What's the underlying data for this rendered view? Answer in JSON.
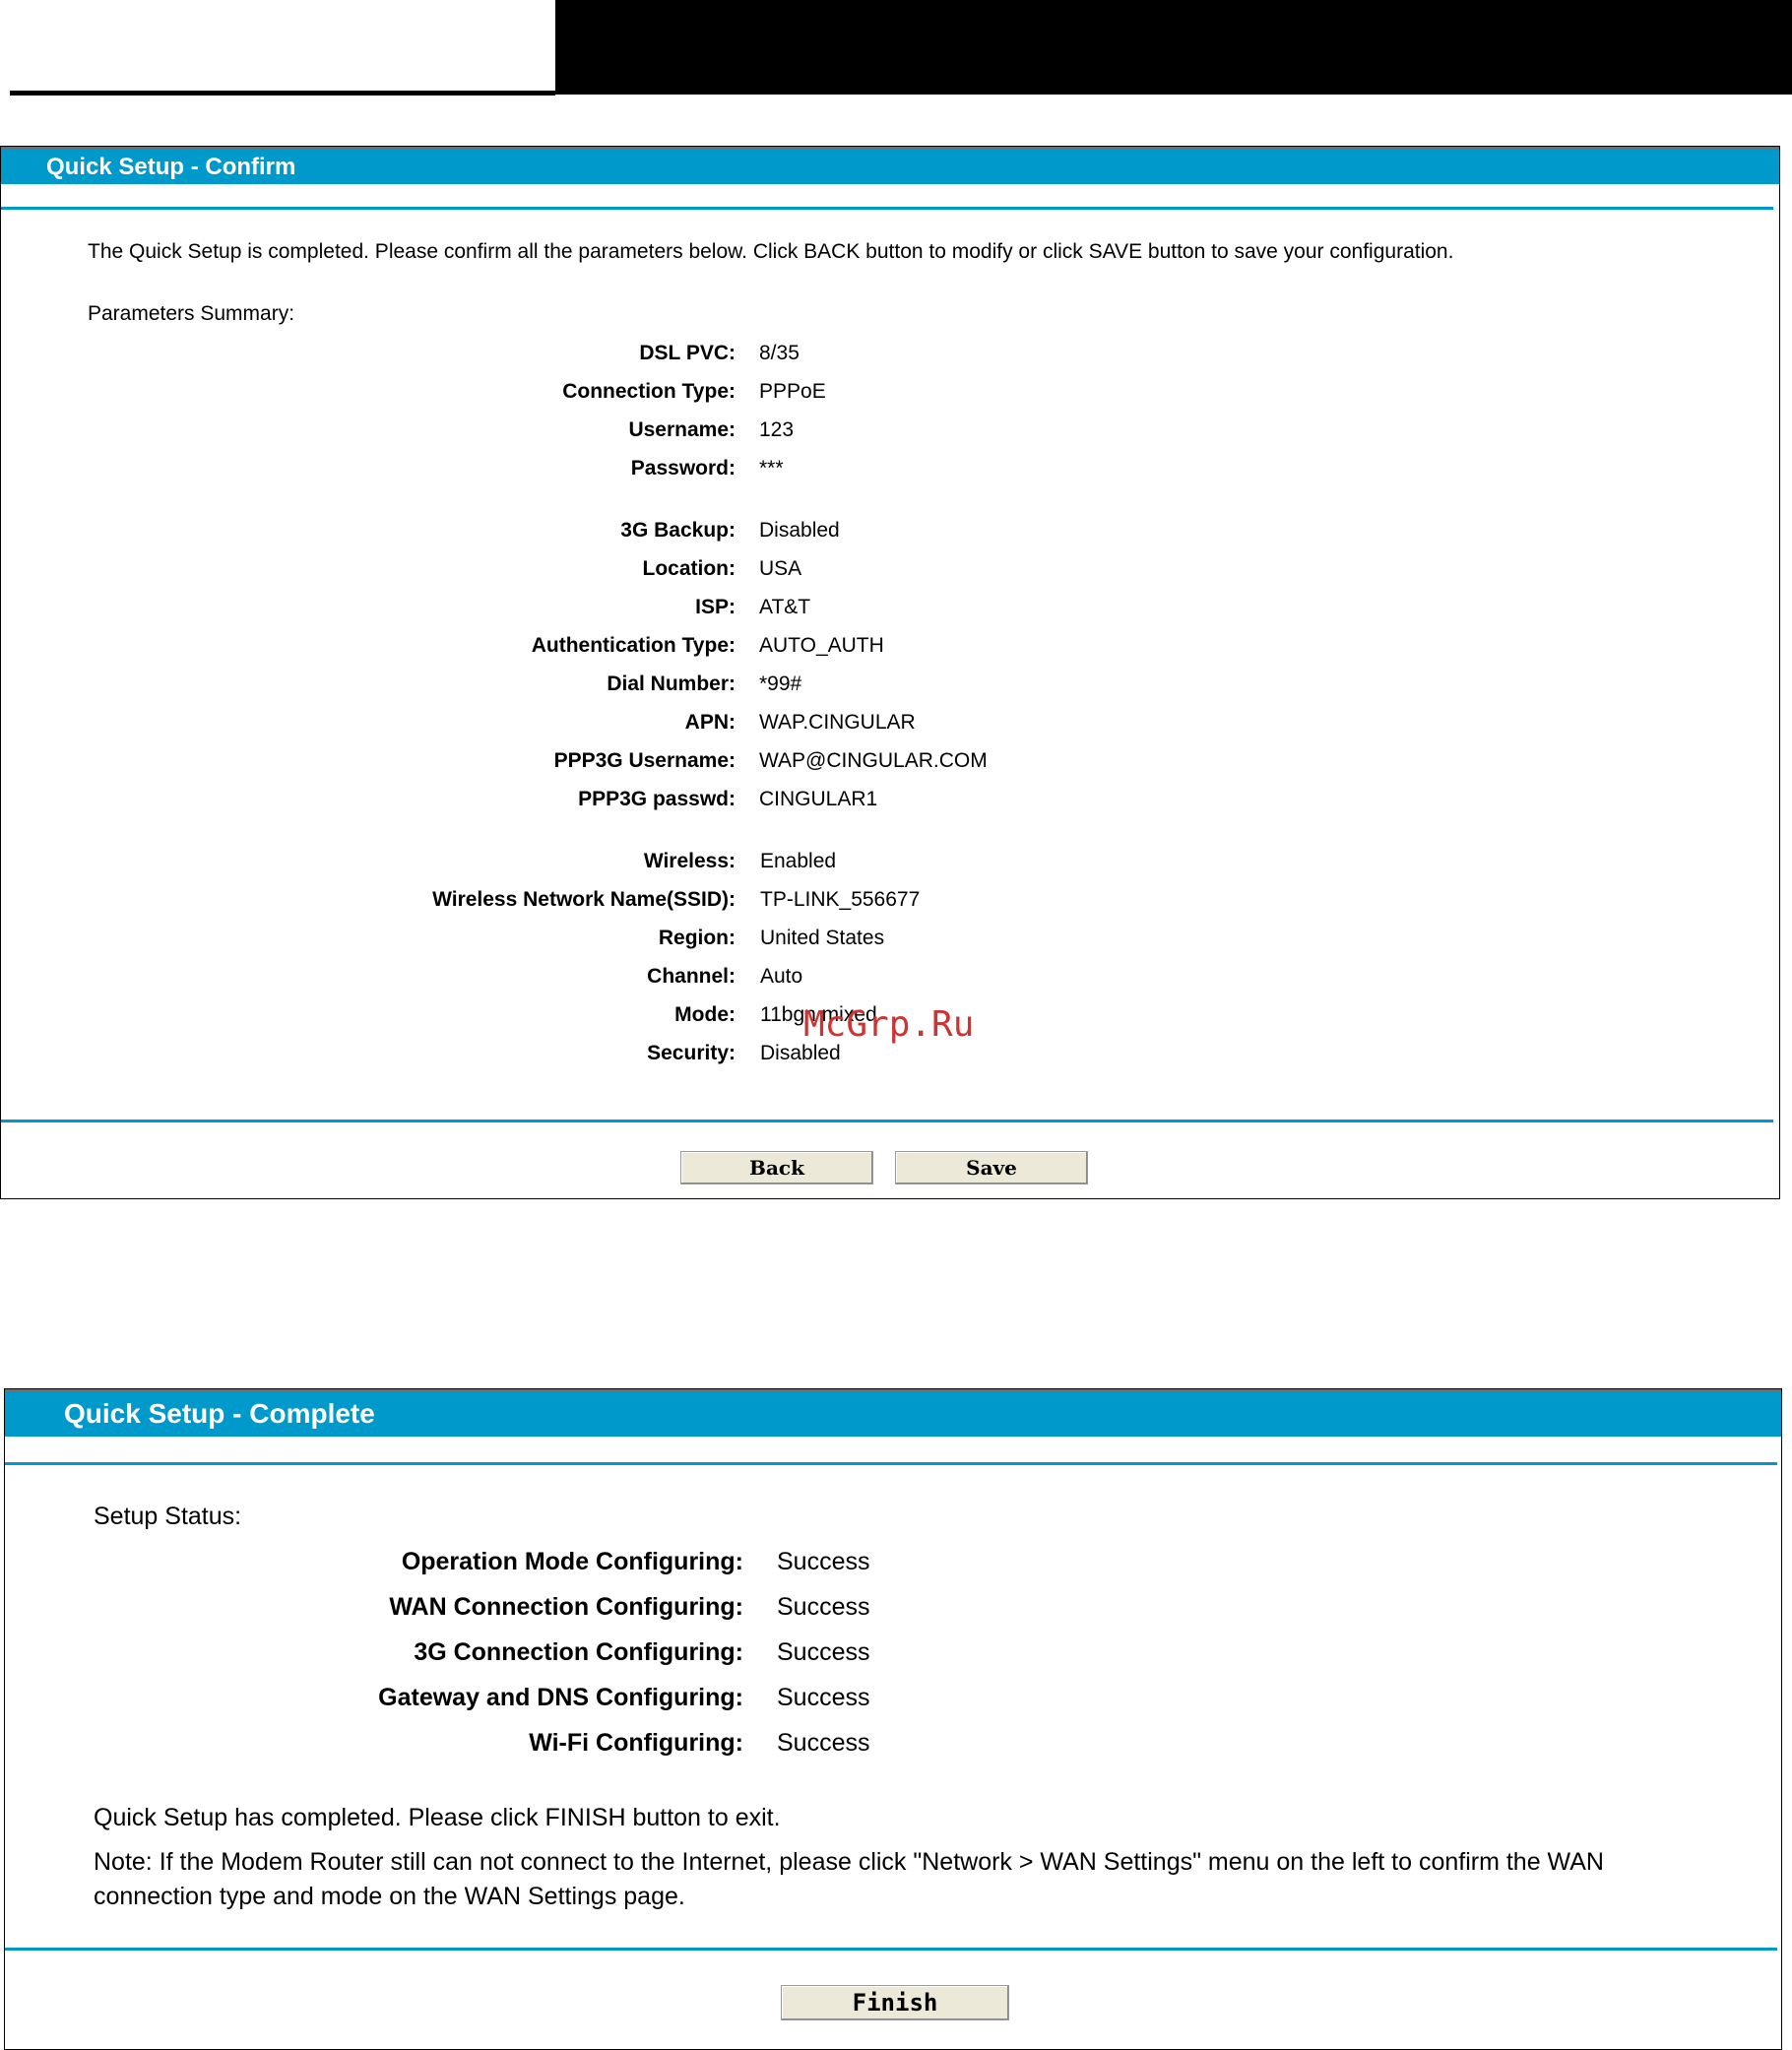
{
  "confirm": {
    "title": "Quick Setup - Confirm",
    "intro": "The Quick Setup is completed. Please confirm all the parameters below. Click BACK button to modify or click SAVE button to save your configuration.",
    "summary_label": "Parameters Summary:",
    "params": [
      {
        "label": "DSL PVC:",
        "value": "8/35"
      },
      {
        "label": "Connection Type:",
        "value": "PPPoE"
      },
      {
        "label": "Username:",
        "value": "123"
      },
      {
        "label": "Password:",
        "value": "***"
      },
      {
        "label": "3G Backup:",
        "value": "Disabled"
      },
      {
        "label": "Location:",
        "value": "USA"
      },
      {
        "label": "ISP:",
        "value": "AT&T"
      },
      {
        "label": "Authentication Type:",
        "value": "AUTO_AUTH"
      },
      {
        "label": "Dial Number:",
        "value": "*99#"
      },
      {
        "label": "APN:",
        "value": "WAP.CINGULAR"
      },
      {
        "label": "PPP3G Username:",
        "value": "WAP@CINGULAR.COM"
      },
      {
        "label": "PPP3G passwd:",
        "value": "CINGULAR1"
      },
      {
        "label": "Wireless:",
        "value": "Enabled"
      },
      {
        "label": "Wireless Network Name(SSID):",
        "value": "TP-LINK_556677"
      },
      {
        "label": "Region:",
        "value": "United States"
      },
      {
        "label": "Channel:",
        "value": "Auto"
      },
      {
        "label": "Mode:",
        "value": "11bgn mixed"
      },
      {
        "label": "Security:",
        "value": "Disabled"
      }
    ],
    "back_label": "Back",
    "save_label": "Save"
  },
  "complete": {
    "title": "Quick Setup - Complete",
    "status_label": "Setup Status:",
    "statuses": [
      {
        "label": "Operation Mode Configuring:",
        "value": "Success"
      },
      {
        "label": "WAN Connection Configuring:",
        "value": "Success"
      },
      {
        "label": "3G Connection Configuring:",
        "value": "Success"
      },
      {
        "label": "Gateway and DNS Configuring:",
        "value": "Success"
      },
      {
        "label": "Wi-Fi Configuring:",
        "value": "Success"
      }
    ],
    "finish_text": "Quick Setup has completed. Please click FINISH button to exit.",
    "note_line1": "Note: If the Modem Router still can not connect to the Internet, please click \"Network > WAN Settings\" menu on the left to confirm the WAN",
    "note_line2": "connection type and mode on the WAN Settings page.",
    "finish_label": "Finish"
  },
  "watermark": "McGrp.Ru"
}
